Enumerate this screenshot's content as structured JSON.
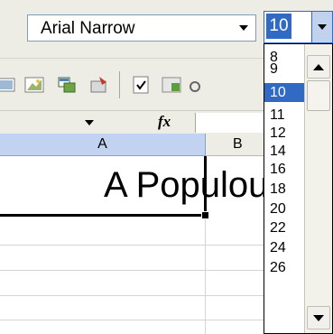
{
  "toolbar": {
    "font_name": "Arial Narrow",
    "font_size": "10"
  },
  "formula_bar": {
    "fx_label": "fx"
  },
  "sheet": {
    "columns": [
      "A",
      "B"
    ],
    "active_cell_text": "A Populous"
  },
  "font_size_dropdown": {
    "options": [
      "8",
      "9",
      "10",
      "11",
      "12",
      "14",
      "16",
      "18",
      "20",
      "22",
      "24",
      "26"
    ],
    "selected": "10"
  },
  "colors": {
    "selection_blue": "#316ac5",
    "header_blue": "#c1d3f0",
    "toolbar_bg": "#eeede5"
  },
  "icons": [
    "picture-icon",
    "chart-icon",
    "copy-format-icon",
    "delete-icon",
    "checkbox-icon",
    "table-icon",
    "wand-icon"
  ]
}
